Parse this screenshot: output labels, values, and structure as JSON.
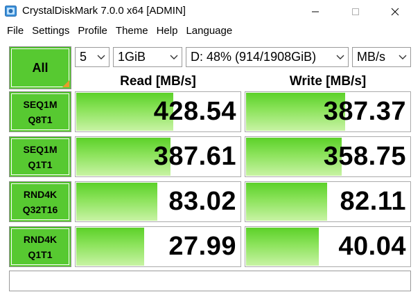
{
  "window": {
    "title": "CrystalDiskMark 7.0.0 x64 [ADMIN]",
    "icon": "crystaldiskmark-app-icon",
    "controls": [
      "minimize-icon",
      "maximize-icon",
      "close-icon"
    ]
  },
  "menu": [
    "File",
    "Settings",
    "Profile",
    "Theme",
    "Help",
    "Language"
  ],
  "toolbar": {
    "all_label": "All",
    "count": "5",
    "size": "1GiB",
    "drive": "D: 48% (914/1908GiB)",
    "unit": "MB/s"
  },
  "headers": {
    "read": "Read [MB/s]",
    "write": "Write [MB/s]"
  },
  "tests": [
    {
      "line1": "SEQ1M",
      "line2": "Q8T1",
      "read": "428.54",
      "write": "387.37",
      "read_fill": 0.59,
      "write_fill": 0.6
    },
    {
      "line1": "SEQ1M",
      "line2": "Q1T1",
      "read": "387.61",
      "write": "358.75",
      "read_fill": 0.57,
      "write_fill": 0.58
    },
    {
      "line1": "RND4K",
      "line2": "Q32T16",
      "read": "83.02",
      "write": "82.11",
      "read_fill": 0.49,
      "write_fill": 0.49
    },
    {
      "line1": "RND4K",
      "line2": "Q1T1",
      "read": "27.99",
      "write": "40.04",
      "read_fill": 0.41,
      "write_fill": 0.44
    }
  ],
  "comment": "",
  "colors": {
    "tile_green": "#57c931",
    "bar_green": "#5cd129",
    "corner_orange": "#e89a2c"
  }
}
